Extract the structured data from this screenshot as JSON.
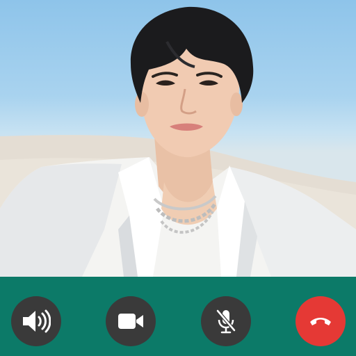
{
  "call": {
    "state": "active"
  },
  "controls": {
    "speaker": {
      "icon": "speaker-icon",
      "color": "#3a3a3a"
    },
    "video": {
      "icon": "video-camera-icon",
      "color": "#3a3a3a"
    },
    "mute": {
      "icon": "microphone-muted-icon",
      "color": "#3a3a3a"
    },
    "end_call": {
      "icon": "phone-hangup-icon",
      "color": "#e53935"
    }
  },
  "colors": {
    "control_bar": "#0c7a68",
    "icon_fg": "#ffffff"
  }
}
